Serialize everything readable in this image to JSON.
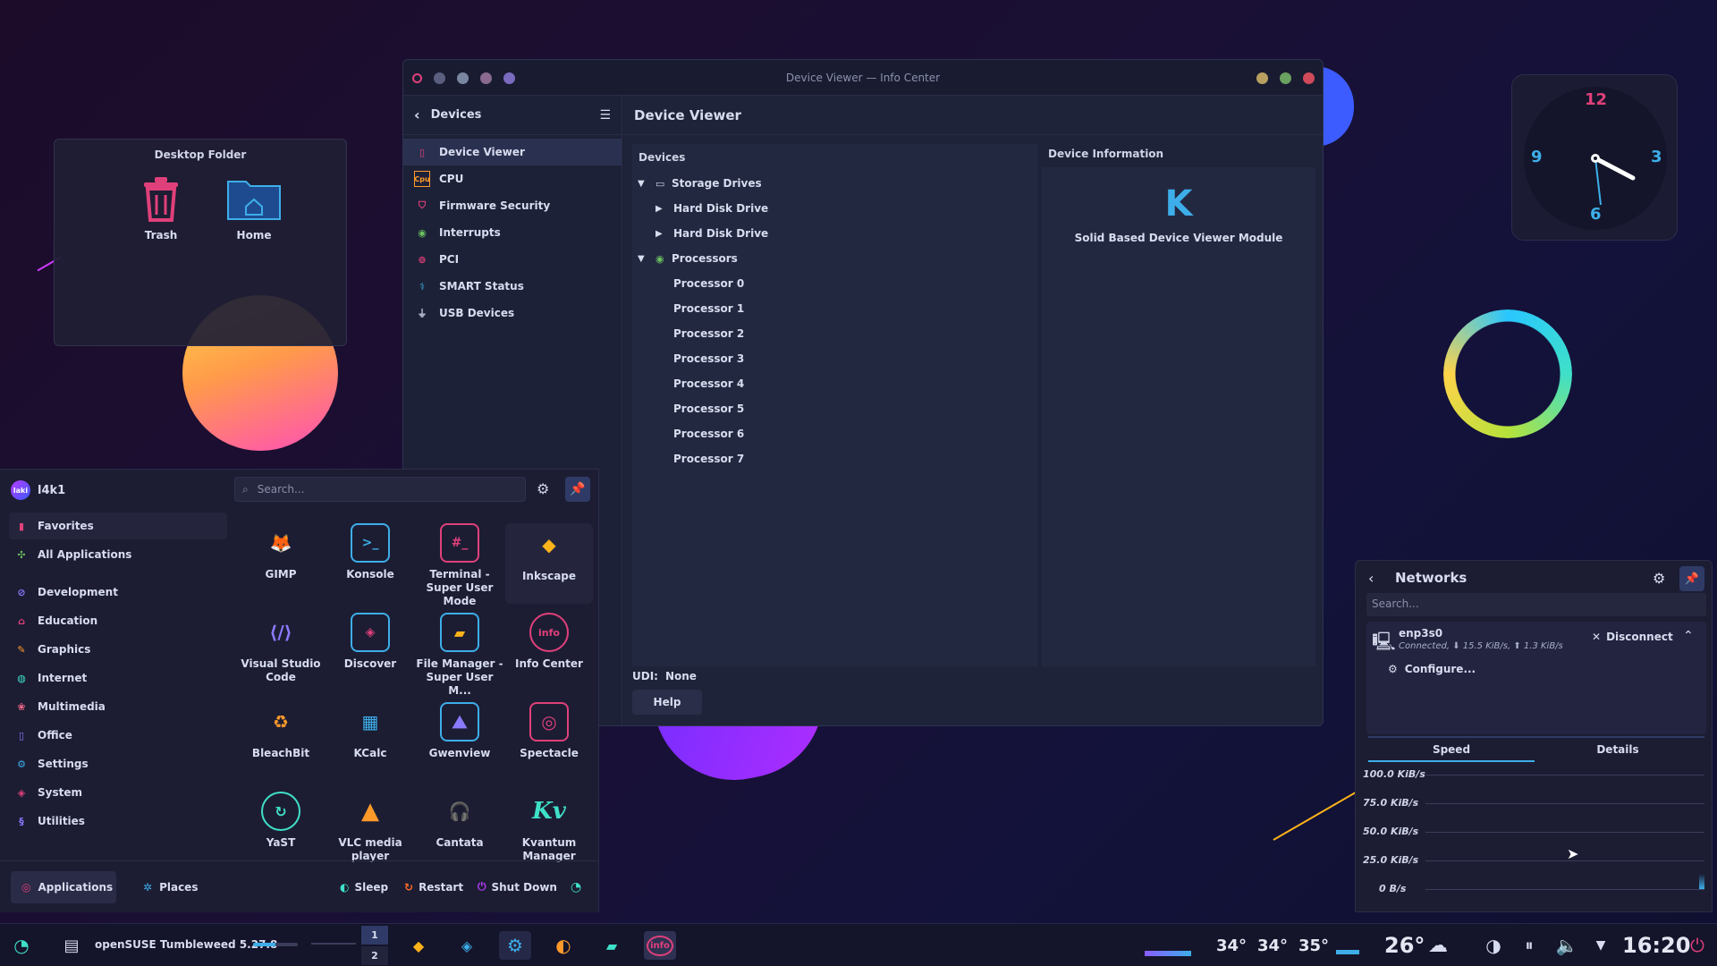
{
  "desktop_folder": {
    "title": "Desktop Folder",
    "items": [
      {
        "label": "Trash",
        "icon": "trash-icon"
      },
      {
        "label": "Home",
        "icon": "home-folder-icon"
      }
    ]
  },
  "clock": {
    "numbers": [
      "12",
      "3",
      "6",
      "9"
    ]
  },
  "window": {
    "title": "Device Viewer — Info Center",
    "sidebar": {
      "header": "Devices",
      "items": [
        {
          "label": "Device Viewer",
          "icon": "device-viewer-icon",
          "selected": true
        },
        {
          "label": "CPU",
          "icon": "cpu-icon"
        },
        {
          "label": "Firmware Security",
          "icon": "shield-icon"
        },
        {
          "label": "Interrupts",
          "icon": "interrupts-icon"
        },
        {
          "label": "PCI",
          "icon": "pci-icon"
        },
        {
          "label": "SMART Status",
          "icon": "stethoscope-icon"
        },
        {
          "label": "USB Devices",
          "icon": "usb-icon"
        }
      ]
    },
    "content": {
      "title": "Device Viewer",
      "devices_header": "Devices",
      "tree": [
        {
          "label": "Storage Drives",
          "level": 0,
          "expanded": true,
          "icon": "drive-icon"
        },
        {
          "label": "Hard Disk Drive",
          "level": 1,
          "expandable": true
        },
        {
          "label": "Hard Disk Drive",
          "level": 1,
          "expandable": true
        },
        {
          "label": "Processors",
          "level": 0,
          "expanded": true,
          "icon": "processor-icon"
        },
        {
          "label": "Processor 0",
          "level": 1
        },
        {
          "label": "Processor 1",
          "level": 1
        },
        {
          "label": "Processor 2",
          "level": 1
        },
        {
          "label": "Processor 3",
          "level": 1
        },
        {
          "label": "Processor 4",
          "level": 1
        },
        {
          "label": "Processor 5",
          "level": 1
        },
        {
          "label": "Processor 6",
          "level": 1
        },
        {
          "label": "Processor 7",
          "level": 1
        }
      ],
      "info_header": "Device Information",
      "info_title": "Solid Based Device Viewer Module",
      "udi_label": "UDI:",
      "udi_value": "None",
      "help_button": "Help"
    }
  },
  "menu": {
    "user": "l4k1",
    "avatar_text": "laki",
    "search_placeholder": "Search...",
    "categories": [
      {
        "label": "Favorites",
        "icon": "favorites-icon",
        "selected": true
      },
      {
        "label": "All Applications",
        "icon": "all-apps-icon"
      },
      {
        "label": "Development",
        "icon": "development-icon"
      },
      {
        "label": "Education",
        "icon": "education-icon"
      },
      {
        "label": "Graphics",
        "icon": "graphics-icon"
      },
      {
        "label": "Internet",
        "icon": "internet-icon"
      },
      {
        "label": "Multimedia",
        "icon": "multimedia-icon"
      },
      {
        "label": "Office",
        "icon": "office-icon"
      },
      {
        "label": "Settings",
        "icon": "settings-icon"
      },
      {
        "label": "System",
        "icon": "system-icon"
      },
      {
        "label": "Utilities",
        "icon": "utilities-icon"
      }
    ],
    "apps": [
      {
        "label": "GIMP",
        "icon": "gimp-icon"
      },
      {
        "label": "Konsole",
        "icon": "konsole-icon"
      },
      {
        "label": "Terminal - Super User Mode",
        "icon": "terminal-su-icon"
      },
      {
        "label": "Inkscape",
        "icon": "inkscape-icon"
      },
      {
        "label": "Visual Studio Code",
        "icon": "vscode-icon"
      },
      {
        "label": "Discover",
        "icon": "discover-icon"
      },
      {
        "label": "File Manager - Super User M...",
        "icon": "file-manager-su-icon"
      },
      {
        "label": "Info Center",
        "icon": "info-center-icon"
      },
      {
        "label": "BleachBit",
        "icon": "bleachbit-icon"
      },
      {
        "label": "KCalc",
        "icon": "kcalc-icon"
      },
      {
        "label": "Gwenview",
        "icon": "gwenview-icon"
      },
      {
        "label": "Spectacle",
        "icon": "spectacle-icon"
      },
      {
        "label": "YaST",
        "icon": "yast-icon"
      },
      {
        "label": "VLC media player",
        "icon": "vlc-icon"
      },
      {
        "label": "Cantata",
        "icon": "cantata-icon"
      },
      {
        "label": "Kvantum Manager",
        "icon": "kvantum-icon"
      }
    ],
    "footer": {
      "applications": "Applications",
      "places": "Places",
      "sleep": "Sleep",
      "restart": "Restart",
      "shutdown": "Shut Down"
    }
  },
  "networks": {
    "title": "Networks",
    "search_placeholder": "Search...",
    "connection": {
      "name": "enp3s0",
      "status": "Connected, ⬇ 15.5 KiB/s, ⬆ 1.3 KiB/s",
      "disconnect": "Disconnect",
      "configure": "Configure..."
    },
    "tabs": [
      "Speed",
      "Details"
    ],
    "graph_labels": [
      "100.0 KiB/s",
      "75.0 KiB/s",
      "50.0 KiB/s",
      "25.0 KiB/s",
      "0 B/s"
    ]
  },
  "taskbar": {
    "title": "openSUSE Tumbleweed 5.27.8",
    "desktops": [
      "1",
      "2"
    ],
    "temps": [
      "34°",
      "34°",
      "35°"
    ],
    "weather": "26°",
    "time": "16:20"
  },
  "colors": {
    "accent": "#3daee9",
    "pink": "#e0407a",
    "bg": "#1c1d33"
  }
}
